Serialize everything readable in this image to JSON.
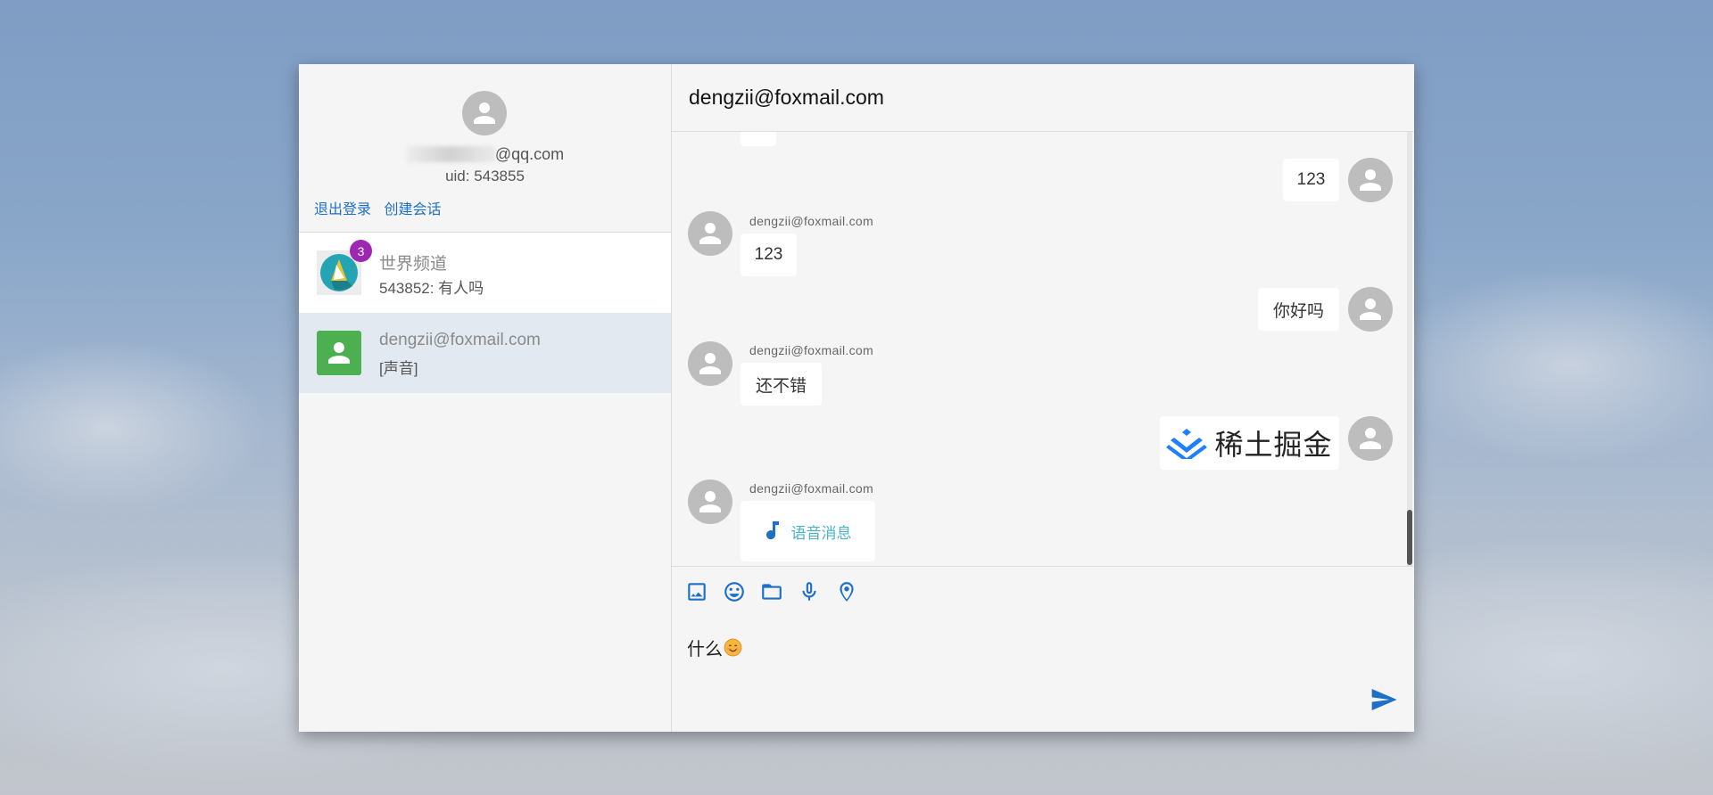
{
  "colors": {
    "accent_blue": "#1e6fc8",
    "badge_purple": "#9c27b0",
    "avatar_green": "#4caf50",
    "avatar_gray": "#bdbdbd",
    "selected_bg": "#e3e9f1",
    "voice_teal": "#4cb2c7"
  },
  "sidebar": {
    "profile": {
      "email_suffix": "@qq.com",
      "uid": "uid: 543855",
      "logout_label": "退出登录",
      "create_session_label": "创建会话"
    },
    "conversations": [
      {
        "name": "世界频道",
        "preview": "543852: 有人吗",
        "badge": "3",
        "icon": "channel-logo-icon"
      },
      {
        "name": "dengzii@foxmail.com",
        "preview": "[声音]",
        "icon": "person-icon",
        "selected": true
      }
    ]
  },
  "chat": {
    "title": "dengzii@foxmail.com",
    "messages": [
      {
        "from": "me",
        "text": "123"
      },
      {
        "from": "peer",
        "sender": "dengzii@foxmail.com",
        "text": "123"
      },
      {
        "from": "me",
        "text": "你好吗"
      },
      {
        "from": "peer",
        "sender": "dengzii@foxmail.com",
        "text": "还不错"
      },
      {
        "from": "me",
        "type": "image",
        "image_text": "稀土掘金"
      },
      {
        "from": "peer",
        "sender": "dengzii@foxmail.com",
        "type": "voice",
        "text": "语音消息"
      }
    ],
    "toolbar": [
      "image-icon",
      "emoji-icon",
      "folder-icon",
      "mic-icon",
      "location-icon"
    ],
    "composer": {
      "value": "什么"
    }
  }
}
